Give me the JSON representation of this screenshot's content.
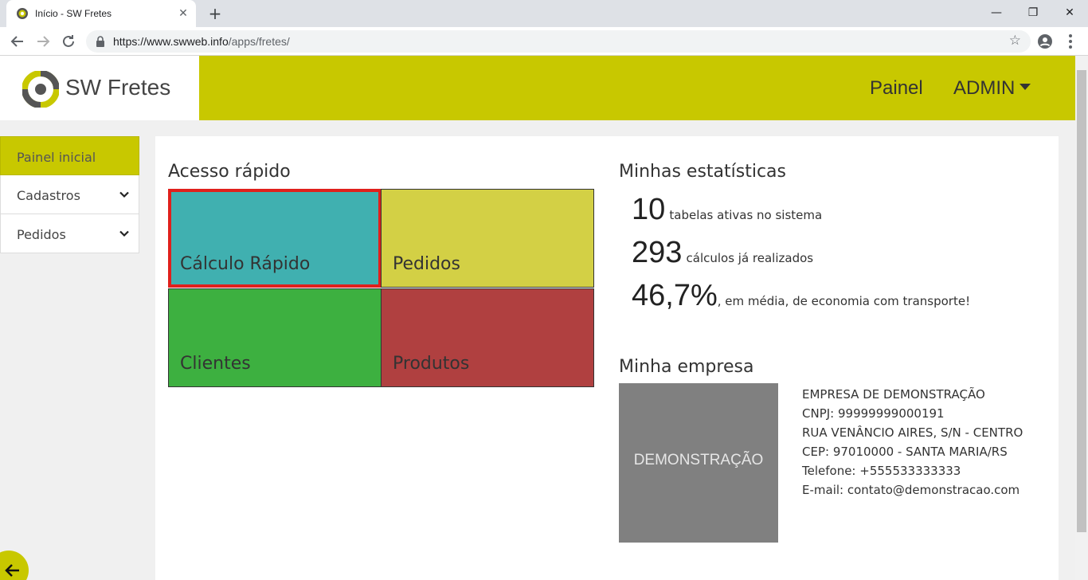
{
  "browser": {
    "tab_title": "Início - SW Fretes",
    "tab_close": "✕",
    "new_tab": "+",
    "url_host": "https://www.swweb.info",
    "url_path": "/apps/fretes/",
    "win_min": "—",
    "win_restore": "❐",
    "win_close": "✕"
  },
  "header": {
    "brand_name": "SW Fretes",
    "nav_painel": "Painel",
    "nav_admin": "ADMIN",
    "brand_color": "#c8c800"
  },
  "sidebar": {
    "items": [
      {
        "label": "Painel inicial"
      },
      {
        "label": "Cadastros"
      },
      {
        "label": "Pedidos"
      }
    ]
  },
  "quick_access": {
    "title": "Acesso rápido",
    "tiles": [
      {
        "label": "Cálculo Rápido",
        "color": "#40b0b0"
      },
      {
        "label": "Pedidos",
        "color": "#d3d045"
      },
      {
        "label": "Clientes",
        "color": "#3db040"
      },
      {
        "label": "Produtos",
        "color": "#b04040"
      }
    ]
  },
  "stats": {
    "title": "Minhas estatísticas",
    "items": [
      {
        "num": "10",
        "desc": "tabelas ativas no sistema"
      },
      {
        "num": "293",
        "desc": "cálculos já realizados"
      },
      {
        "num": "46,7%",
        "desc": ", em média, de economia com transporte!"
      }
    ]
  },
  "company": {
    "title": "Minha empresa",
    "image_label": "DEMONSTRAÇÃO",
    "name": "EMPRESA DE DEMONSTRAÇÃO",
    "cnpj": "CNPJ: 99999999000191",
    "address": "RUA VENÂNCIO AIRES, S/N - CENTRO",
    "cep": "CEP: 97010000 - SANTA MARIA/RS",
    "phone": "Telefone: +555533333333",
    "email": "E-mail: contato@demonstracao.com"
  }
}
